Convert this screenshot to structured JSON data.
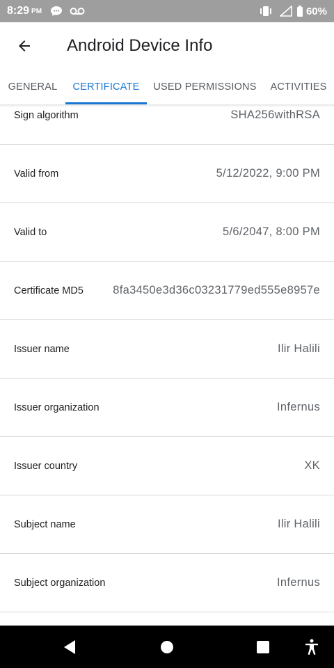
{
  "status_bar": {
    "time": "8:29",
    "ampm": "PM",
    "battery": "60%",
    "icons": [
      "chat-bubble-icon",
      "voicemail-icon",
      "vibrate-icon",
      "signal-icon",
      "battery-icon"
    ]
  },
  "app_bar": {
    "title": "Android Device Info",
    "back_icon": "arrow-back-icon"
  },
  "tabs": [
    {
      "label": "GENERAL",
      "active": false
    },
    {
      "label": "CERTIFICATE",
      "active": true
    },
    {
      "label": "USED PERMISSIONS",
      "active": false
    },
    {
      "label": "ACTIVITIES",
      "active": false
    }
  ],
  "rows": [
    {
      "label": "Sign algorithm",
      "value": "SHA256withRSA"
    },
    {
      "label": "Valid from",
      "value": "5/12/2022, 9:00 PM"
    },
    {
      "label": "Valid to",
      "value": "5/6/2047, 8:00 PM"
    },
    {
      "label": "Certificate MD5",
      "value": "8fa3450e3d36c03231779ed555e8957e"
    },
    {
      "label": "Issuer name",
      "value": "Ilir Halili"
    },
    {
      "label": "Issuer organization",
      "value": "Infernus"
    },
    {
      "label": "Issuer country",
      "value": "XK"
    },
    {
      "label": "Subject name",
      "value": "Ilir Halili"
    },
    {
      "label": "Subject organization",
      "value": "Infernus"
    }
  ],
  "nav_bar": {
    "icons": [
      "back-triangle-icon",
      "home-circle-icon",
      "recents-square-icon",
      "accessibility-icon"
    ]
  },
  "colors": {
    "accent": "#1976d2",
    "status_bar": "#9e9e9e",
    "nav_bar": "#000000"
  }
}
